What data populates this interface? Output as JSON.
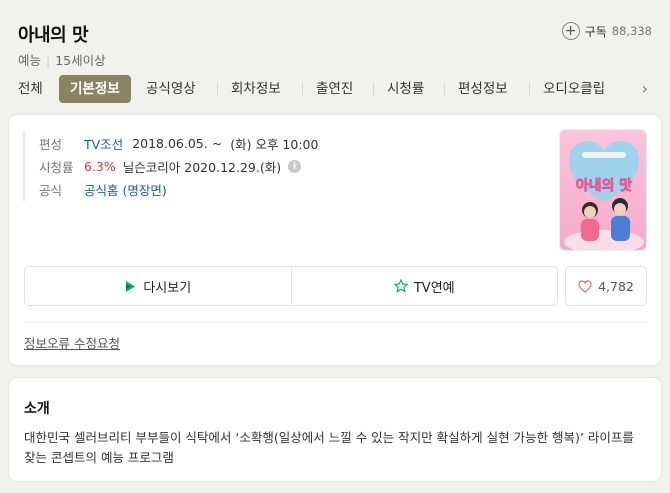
{
  "header": {
    "title": "아내의 맛",
    "genre": "예능",
    "rating": "15세이상",
    "subscribe_label": "구독",
    "subscribe_count": "88,338"
  },
  "tabs": [
    {
      "label": "전체"
    },
    {
      "label": "기본정보",
      "active": true
    },
    {
      "label": "공식영상"
    },
    {
      "label": "회차정보"
    },
    {
      "label": "출연진"
    },
    {
      "label": "시청률"
    },
    {
      "label": "편성정보"
    },
    {
      "label": "오디오클립"
    }
  ],
  "info": {
    "broadcast_label": "편성",
    "broadcast_channel": "TV조선",
    "broadcast_date": "2018.06.05. ~",
    "broadcast_day": "(화)",
    "broadcast_time": "오후 10:00",
    "ratings_label": "시청률",
    "ratings_value": "6.3%",
    "ratings_source": "닐슨코리아",
    "ratings_date": "2020.12.29.(화)",
    "official_label": "공식",
    "official_link": "공식홈 (명장면)"
  },
  "poster": {
    "title_art": "아내의 맛",
    "colors": {
      "pink": "#f4a3c6",
      "blue": "#8fd6f0",
      "bg": "#fbe3ee"
    }
  },
  "actions": {
    "rewatch_label": "다시보기",
    "tv_label": "TV연예",
    "like_count": "4,782"
  },
  "report_label": "정보오류 수정요청",
  "intro": {
    "title": "소개",
    "text": "대한민국 셀러브리티 부부들이 식탁에서 ‘소확행(일상에서 느낄 수 있는 작지만 확실하게 실현 가능한 행복)’ 라이프를 찾는 콘셉트의 예능 프로그램"
  },
  "colors": {
    "tab_active_bg": "#8a8465",
    "link": "#1d5ba8",
    "rating_red": "#e2372b",
    "rewatch_icon": "#12b34f",
    "star_icon": "#12b34f",
    "heart_icon": "#e06b6b"
  }
}
